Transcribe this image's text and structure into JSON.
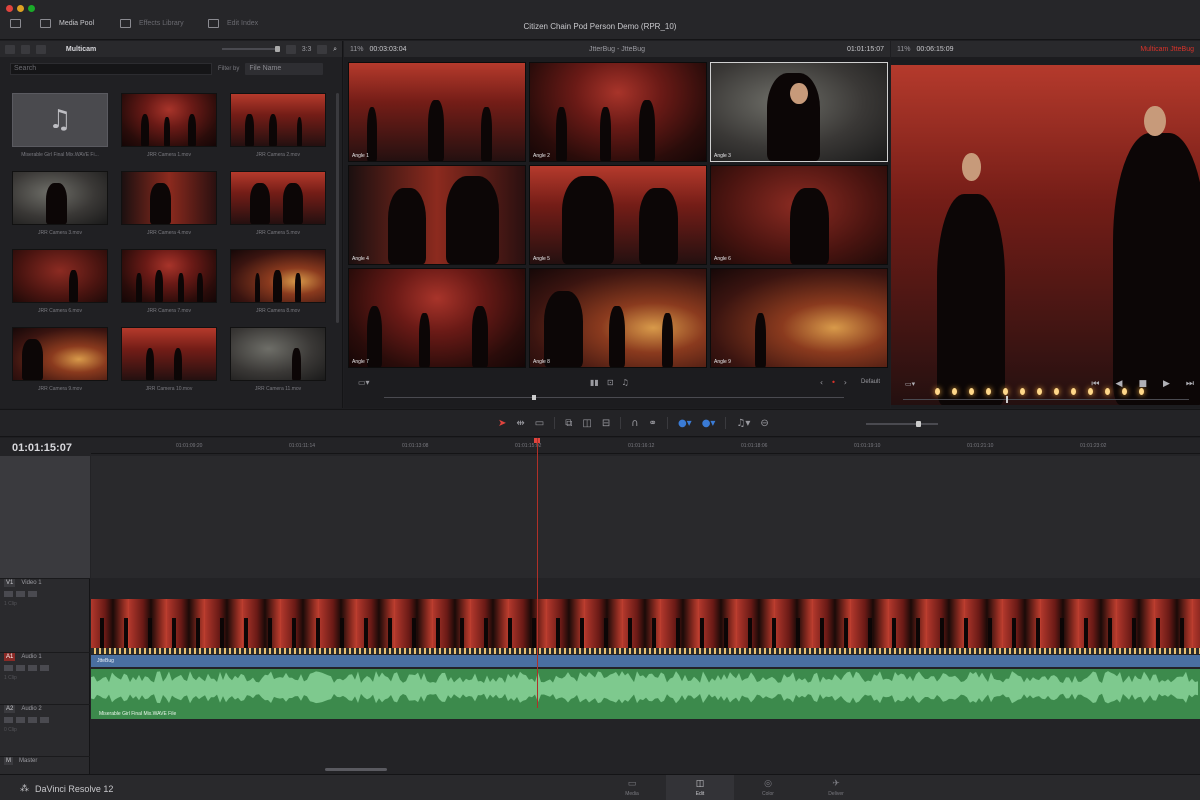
{
  "window": {
    "title": "Citizen Chain Pod Person Demo (RPR_10)",
    "toolbar": [
      {
        "label": "Media Pool",
        "icon": "media-pool-icon"
      },
      {
        "label": "Effects Library",
        "icon": "effects-library-icon"
      },
      {
        "label": "Edit Index",
        "icon": "edit-index-icon"
      }
    ]
  },
  "media_pool": {
    "bin": "Multicam",
    "count": "3:3",
    "search_placeholder": "Search",
    "filter_label": "Filter by",
    "filter_value": "File Name",
    "clips": [
      {
        "name": "Miserable Girl Final Mix.WAVE Fi...",
        "type": "audio"
      },
      {
        "name": "JRR Camera 1.mov",
        "type": "video"
      },
      {
        "name": "JRR Camera 2.mov",
        "type": "video"
      },
      {
        "name": "JRR Camera 3.mov",
        "type": "video"
      },
      {
        "name": "JRR Camera 4.mov",
        "type": "video"
      },
      {
        "name": "JRR Camera 5.mov",
        "type": "video"
      },
      {
        "name": "JRR Camera 6.mov",
        "type": "video"
      },
      {
        "name": "JRR Camera 7.mov",
        "type": "video"
      },
      {
        "name": "JRR Camera 8.mov",
        "type": "video"
      },
      {
        "name": "JRR Camera 9.mov",
        "type": "video"
      },
      {
        "name": "JRR Camera 10.mov",
        "type": "video"
      },
      {
        "name": "JRR Camera 11.mov",
        "type": "video"
      }
    ]
  },
  "source_viewer": {
    "zoom": "11%",
    "timecode": "00:03:03:04",
    "clip_name": "JtterBug - JtteBug",
    "timecode_right": "01:01:15:07",
    "angles": [
      "Angle 1",
      "Angle 2",
      "Angle 3",
      "Angle 4",
      "Angle 5",
      "Angle 6",
      "Angle 7",
      "Angle 8",
      "Angle 9"
    ],
    "active_angle": 3,
    "display_mode": "Default",
    "scrub_position": 0.33
  },
  "timeline_viewer": {
    "zoom": "11%",
    "timecode": "00:06:15:09",
    "timeline_name": "Multicam JtteBug",
    "scrub_position": 0.36
  },
  "timeline": {
    "current_timecode": "01:01:15:07",
    "ruler": [
      "01:01:09:20",
      "01:01:11:14",
      "01:01:13:08",
      "01:01:15:02",
      "01:01:16:12",
      "01:01:18:06",
      "01:01:19:10",
      "01:01:21:10",
      "01:01:23:02"
    ],
    "tracks": [
      {
        "code": "V1",
        "name": "Video 1",
        "sub": "1 Clip",
        "active": false
      },
      {
        "code": "A1",
        "name": "Audio 1",
        "sub": "1 Clip",
        "active": true
      },
      {
        "code": "A2",
        "name": "Audio 2",
        "sub": "0 Clip",
        "active": false
      },
      {
        "code": "M",
        "name": "Master",
        "sub": "",
        "active": false
      }
    ],
    "video_clip_label": "JtteBug",
    "audio_clip_label": "Miserable Girl Final Mix.WAVE File"
  },
  "pagebar": {
    "app_name": "DaVinci Resolve 12",
    "pages": [
      {
        "label": "Media",
        "icon": "media-page-icon"
      },
      {
        "label": "Edit",
        "icon": "edit-page-icon"
      },
      {
        "label": "Color",
        "icon": "color-page-icon"
      },
      {
        "label": "Deliver",
        "icon": "deliver-page-icon"
      }
    ],
    "active_page": "Edit"
  },
  "colors": {
    "accent_red": "#e0443e",
    "video_clip": "#4a6fa0",
    "audio_clip": "#3c8a4c"
  }
}
